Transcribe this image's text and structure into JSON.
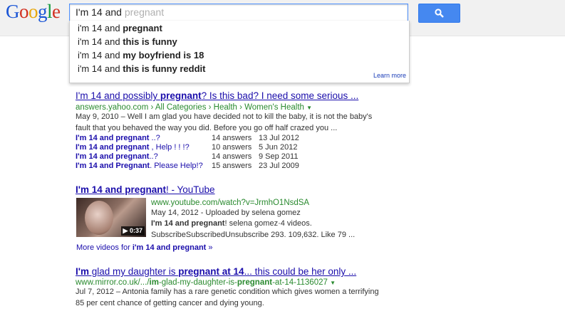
{
  "search": {
    "typed": "I'm 14 and",
    "ghost": "pregnant",
    "suggestions": [
      {
        "prefix": "i'm 14 and ",
        "bold": "pregnant"
      },
      {
        "prefix": "i'm 14 and ",
        "bold": "this is funny"
      },
      {
        "prefix": "i'm 14 and ",
        "bold": "my boyfriend is 18"
      },
      {
        "prefix": "i'm 14 and ",
        "bold": "this is funny reddit"
      }
    ],
    "learn_more": "Learn more"
  },
  "icons": {
    "search_button": "magnifier-icon",
    "url_dropdown": "caret-down-icon",
    "video_play": "play-icon"
  },
  "colors": {
    "accent": "#4588f0",
    "link": "#1a0dab",
    "url": "#2a8a2f"
  },
  "results": [
    {
      "title": {
        "p1": "I'm 14 and possibly ",
        "b1": "pregnant",
        "p2": "? Is this bad? I need some serious ..."
      },
      "url": "answers.yahoo.com › All Categories › Health › Women's Health",
      "snippet": [
        "May 9, 2010 – Well I am glad you have decided not to kill the baby, it is not the baby's",
        "fault that you behaved the way you did. Before you go off half crazed you ..."
      ],
      "sublinks": [
        {
          "bold": "I'm 14 and pregnant",
          "rest": " ..?",
          "answers": "14 answers",
          "date": "13 Jul 2012"
        },
        {
          "bold": "I'm 14 and pregnant",
          "rest": " , Help ! ! !?",
          "answers": "10 answers",
          "date": "5 Jun 2012"
        },
        {
          "bold": "I'm 14 and pregnant",
          "rest": "..?",
          "answers": "14 answers",
          "date": "9 Sep 2011"
        },
        {
          "bold": "I'm 14 and Pregnant",
          "rest": ". Please Help!?",
          "answers": "15 answers",
          "date": "23 Jul 2009"
        }
      ]
    },
    {
      "title": {
        "b1": "I'm 14 and pregnant",
        "p2": "! - YouTube"
      },
      "url": "www.youtube.com/watch?v=JrmhO1NsdSA",
      "meta": "May 14, 2012 - Uploaded by selena gomez",
      "snippet": {
        "bold": "I'm 14 and pregnant",
        "rest": "! selena gomez·4 videos."
      },
      "snippet2": "SubscribeSubscribedUnsubscribe 293. 109,632. Like 79 ...",
      "duration": "0:37",
      "more_prefix": "More videos for ",
      "more_bold": "i'm 14 and pregnant",
      "more_suffix": " »"
    },
    {
      "title": {
        "b1": "I'm",
        "p1": " glad my daughter is ",
        "b2": "pregnant at 14",
        "p2": "... this could be her only ..."
      },
      "url": {
        "plain": "www.mirror.co.uk/.../",
        "bold": "im",
        "mid": "-glad-my-daughter-is-",
        "bold2": "pregnant",
        "tail": "-at-14-1136027"
      },
      "snippet": [
        "Jul 7, 2012 – Antonia family has a rare genetic condition which gives women a terrifying",
        "85 per cent chance of getting cancer and dying young."
      ]
    }
  ]
}
